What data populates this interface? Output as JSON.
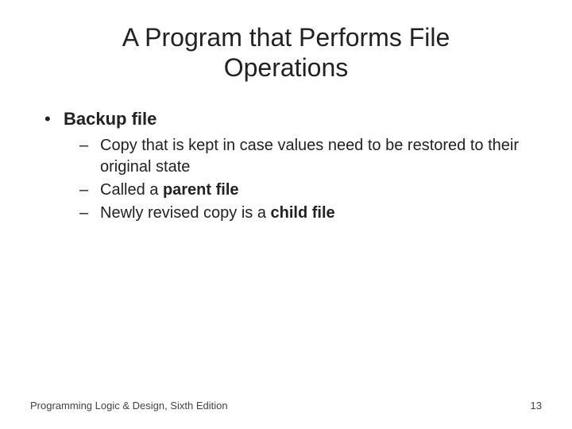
{
  "title": "A Program that Performs File Operations",
  "bullet1": "Backup file",
  "sub1": "Copy that is kept in case values need to be restored to their original state",
  "sub2_prefix": "Called a ",
  "sub2_bold": "parent file",
  "sub3_prefix": "Newly revised copy is a ",
  "sub3_bold": "child file",
  "footer_left": "Programming Logic & Design, Sixth Edition",
  "footer_right": "13"
}
